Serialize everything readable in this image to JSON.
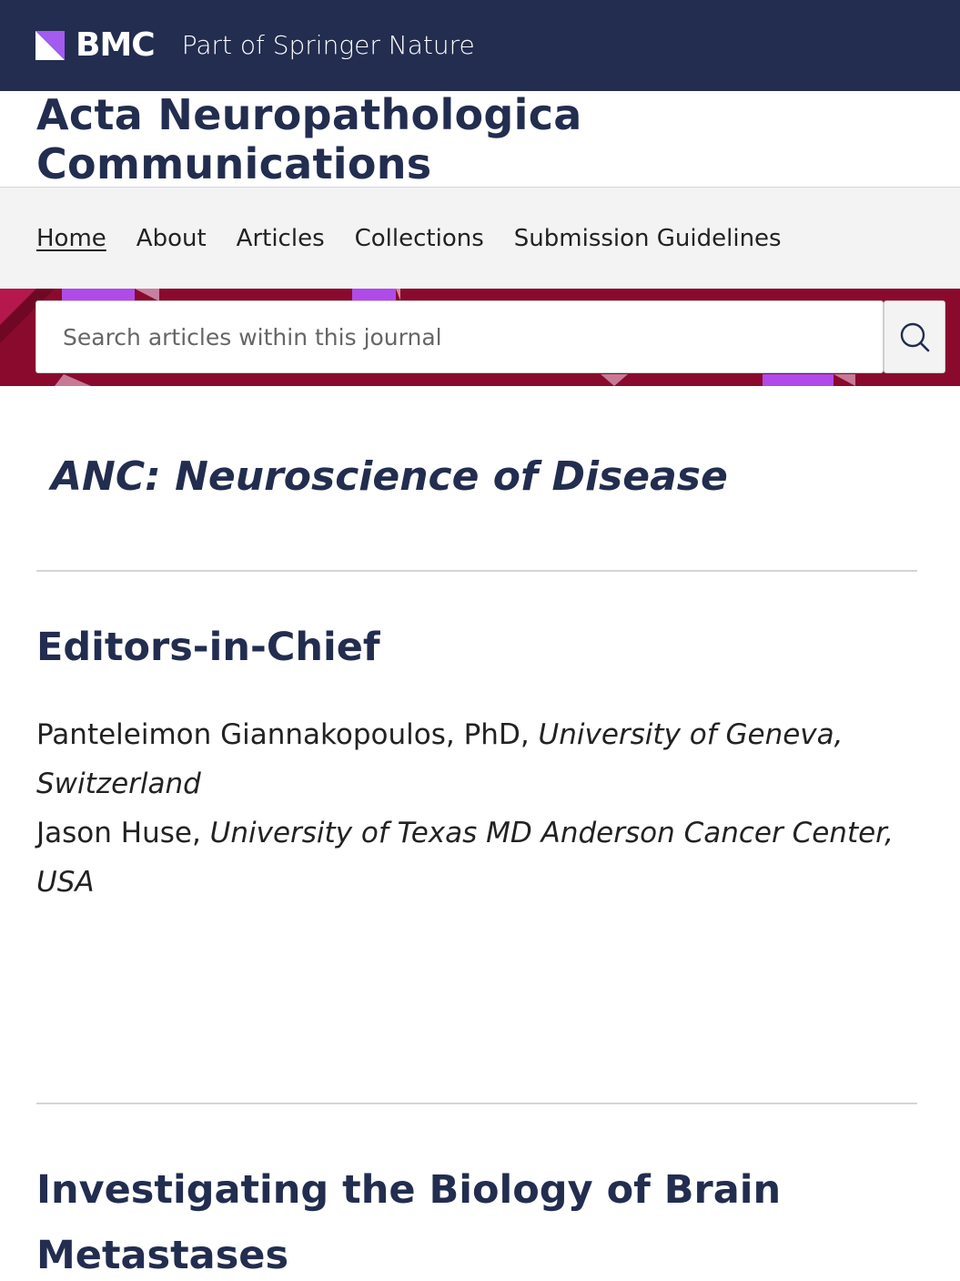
{
  "topbar": {
    "brand": "BMC",
    "tagline": "Part of Springer Nature",
    "brand_color": "#222d4f",
    "logo_accent": "#a35bf0"
  },
  "journal": {
    "title": "Acta Neuropathologica Communications"
  },
  "nav": {
    "items": [
      {
        "label": "Home",
        "active": true
      },
      {
        "label": "About",
        "active": false
      },
      {
        "label": "Articles",
        "active": false
      },
      {
        "label": "Collections",
        "active": false
      },
      {
        "label": "Submission Guidelines",
        "active": false
      }
    ]
  },
  "search": {
    "placeholder": "Search articles within this journal",
    "value": "",
    "button_icon": "search-icon",
    "band_color": "#8a0a2e"
  },
  "main": {
    "anc_title": "ANC: Neuroscience of Disease",
    "editors_title": "Editors-in-Chief",
    "editors": [
      {
        "name": "Panteleimon Giannakopoulos, PhD, ",
        "affiliation": "University of Geneva, Switzerland"
      },
      {
        "name": "Jason Huse, ",
        "affiliation": "University of Texas MD Anderson Cancer Center, USA"
      }
    ],
    "next_section_title": "Investigating the Biology of Brain Metastases"
  }
}
